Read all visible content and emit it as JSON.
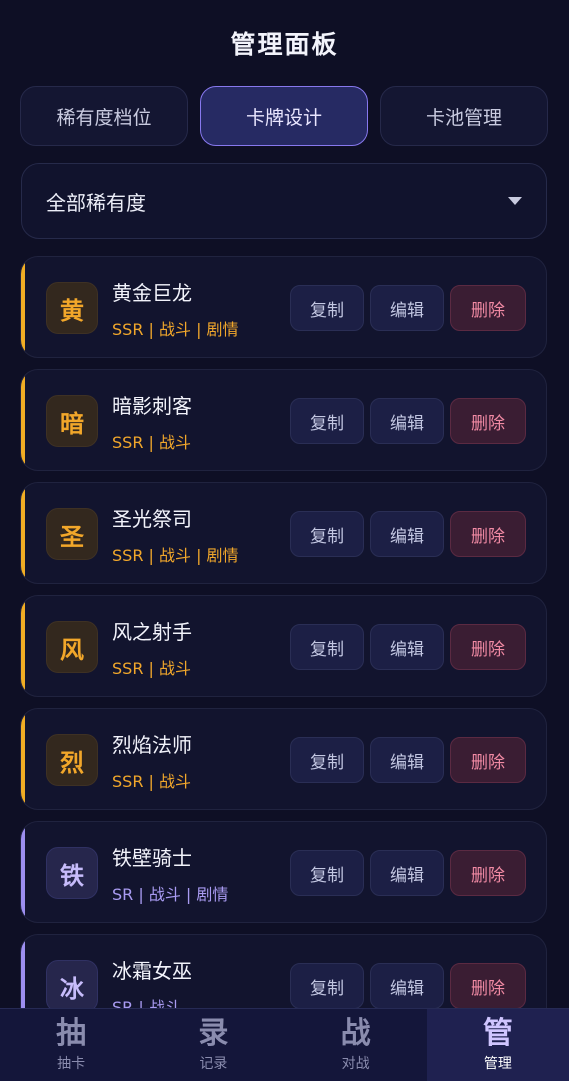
{
  "header": {
    "title": "管理面板"
  },
  "tabs": [
    {
      "label": "稀有度档位"
    },
    {
      "label": "卡牌设计",
      "active": true
    },
    {
      "label": "卡池管理"
    }
  ],
  "filter": {
    "selected": "全部稀有度",
    "icon": "caret-down-icon"
  },
  "colors": {
    "accent_ssr": "#f1ad24",
    "accent_sr": "#9d8ff0",
    "active_tab_border": "#8778ee",
    "delete_text": "#f18aa4",
    "background": "#0e0f25"
  },
  "cards": [
    {
      "glyph": "黄",
      "name": "黄金巨龙",
      "tags": "SSR | 战斗 | 剧情",
      "rarity": "ssr",
      "copy": "复制",
      "edit": "编辑",
      "delete": "删除"
    },
    {
      "glyph": "暗",
      "name": "暗影刺客",
      "tags": "SSR | 战斗",
      "rarity": "ssr",
      "copy": "复制",
      "edit": "编辑",
      "delete": "删除"
    },
    {
      "glyph": "圣",
      "name": "圣光祭司",
      "tags": "SSR | 战斗 | 剧情",
      "rarity": "ssr",
      "copy": "复制",
      "edit": "编辑",
      "delete": "删除"
    },
    {
      "glyph": "风",
      "name": "风之射手",
      "tags": "SSR | 战斗",
      "rarity": "ssr",
      "copy": "复制",
      "edit": "编辑",
      "delete": "删除"
    },
    {
      "glyph": "烈",
      "name": "烈焰法师",
      "tags": "SSR | 战斗",
      "rarity": "ssr",
      "copy": "复制",
      "edit": "编辑",
      "delete": "删除"
    },
    {
      "glyph": "铁",
      "name": "铁壁骑士",
      "tags": "SR | 战斗 | 剧情",
      "rarity": "sr",
      "copy": "复制",
      "edit": "编辑",
      "delete": "删除"
    },
    {
      "glyph": "冰",
      "name": "冰霜女巫",
      "tags": "SR | 战斗",
      "rarity": "sr",
      "copy": "复制",
      "edit": "编辑",
      "delete": "删除"
    }
  ],
  "nav": [
    {
      "glyph": "抽",
      "label": "抽卡"
    },
    {
      "glyph": "录",
      "label": "记录"
    },
    {
      "glyph": "战",
      "label": "对战"
    },
    {
      "glyph": "管",
      "label": "管理",
      "active": true
    }
  ]
}
